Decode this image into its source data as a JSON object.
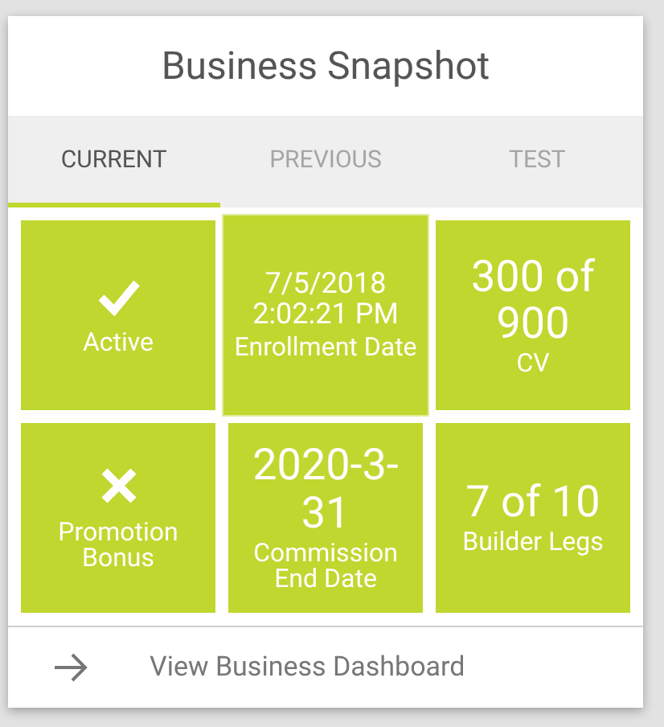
{
  "title": "Business Snapshot",
  "tabs": [
    {
      "label": "CURRENT",
      "selected": true
    },
    {
      "label": "PREVIOUS",
      "selected": false
    },
    {
      "label": "TEST",
      "selected": false
    }
  ],
  "tiles": [
    {
      "kind": "check",
      "label": "Active",
      "hovered": false
    },
    {
      "kind": "value",
      "value": "7/5/2018 2:02:21 PM",
      "label": "Enrollment Date",
      "hovered": true
    },
    {
      "kind": "value",
      "value": "300 of 900",
      "label": "CV",
      "hovered": false
    },
    {
      "kind": "cross",
      "label": "Promotion Bonus",
      "hovered": false
    },
    {
      "kind": "value",
      "value": "2020-3-31",
      "label": "Commission End Date",
      "hovered": false
    },
    {
      "kind": "value",
      "value": "7 of 10",
      "label": "Builder Legs",
      "hovered": false
    }
  ],
  "footer_link": "View Business Dashboard"
}
